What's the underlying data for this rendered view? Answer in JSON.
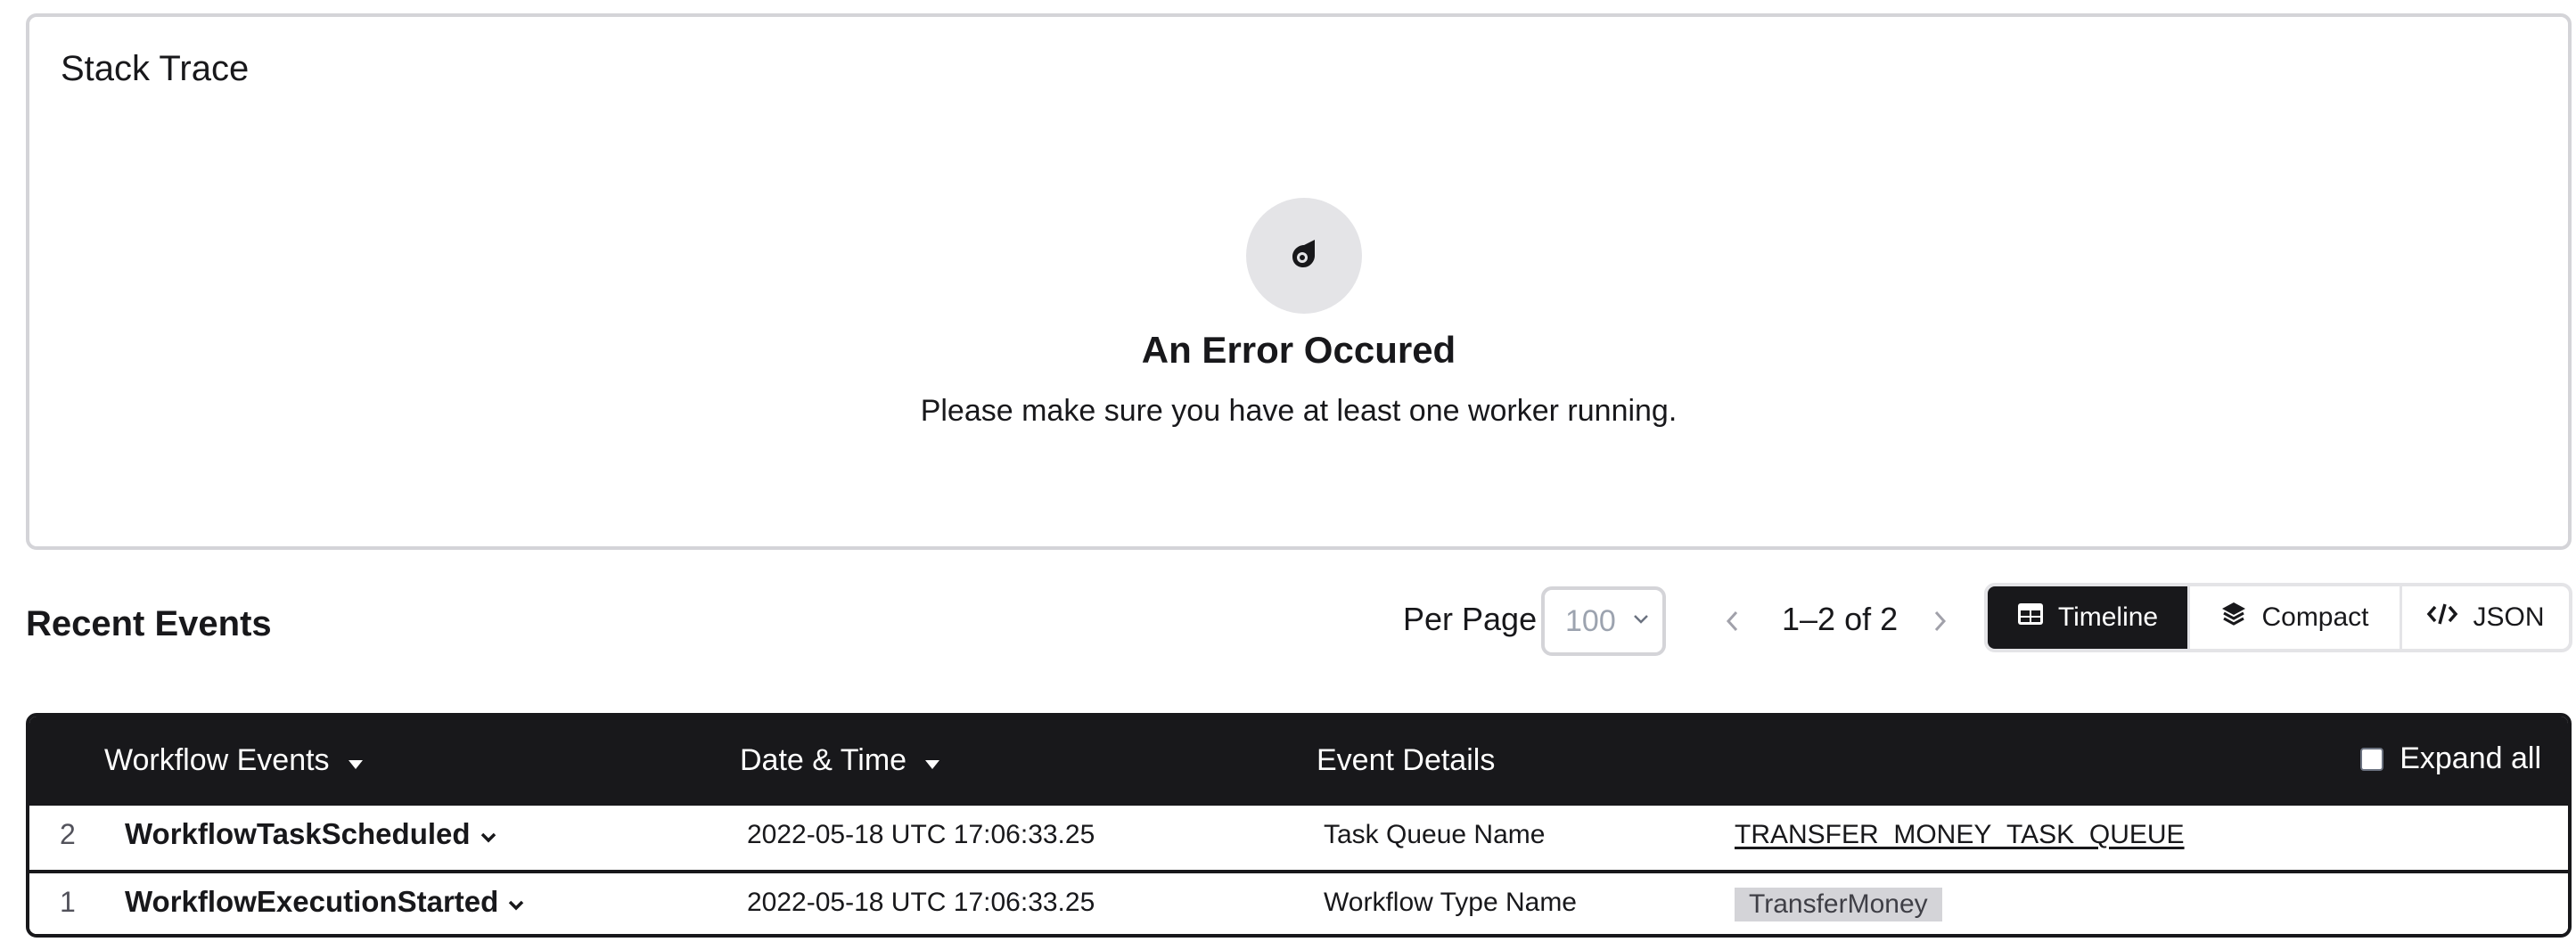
{
  "stack_trace": {
    "title": "Stack Trace",
    "error_title": "An Error Occured",
    "error_message": "Please make sure you have at least one worker running.",
    "icon": "comet-icon"
  },
  "recent_events": {
    "title": "Recent Events",
    "per_page_label": "Per Page",
    "per_page_value": "100",
    "page_range": "1–2 of 2",
    "views": [
      {
        "label": "Timeline",
        "icon": "table-icon",
        "active": true
      },
      {
        "label": "Compact",
        "icon": "layers-icon",
        "active": false
      },
      {
        "label": "JSON",
        "icon": "code-icon",
        "active": false
      }
    ]
  },
  "table": {
    "columns": {
      "events": "Workflow Events",
      "date": "Date & Time",
      "details": "Event Details"
    },
    "expand_all": "Expand all",
    "rows": [
      {
        "id": "2",
        "name": "WorkflowTaskScheduled",
        "date": "2022-05-18 UTC 17:06:33.25",
        "detail_label": "Task Queue Name",
        "detail_value": "TRANSFER_MONEY_TASK_QUEUE"
      },
      {
        "id": "1",
        "name": "WorkflowExecutionStarted",
        "date": "2022-05-18 UTC 17:06:33.25",
        "detail_label": "Workflow Type Name",
        "detail_value": "TransferMoney"
      }
    ]
  },
  "colors": {
    "dark": "#18181b",
    "border": "#d4d4d8",
    "icon_bg": "#e4e4e7"
  }
}
